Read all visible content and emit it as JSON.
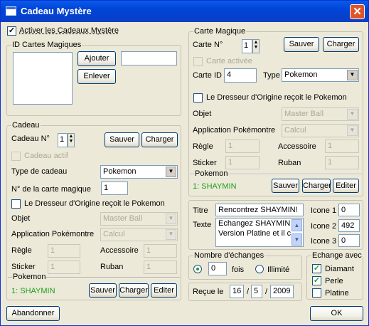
{
  "window": {
    "title": "Cadeau Mystère",
    "close_glyph": "✕"
  },
  "activate_label": "Activer les Cadeaux Mystère",
  "id_cards": {
    "title": "ID Cartes Magiques",
    "add": "Ajouter",
    "remove": "Enlever",
    "input_value": ""
  },
  "cadeau": {
    "title": "Cadeau",
    "num_label": "Cadeau N°",
    "num_value": "1",
    "save": "Sauver",
    "load": "Charger",
    "active_label": "Cadeau actif",
    "type_label": "Type de cadeau",
    "type_value": "Pokemon",
    "card_num_label": "N° de la carte magique",
    "card_num_value": "1",
    "trainer_label": "Le Dresseur d'Origine reçoit le Pokemon",
    "objet_label": "Objet",
    "objet_value": "Master Ball",
    "app_label": "Application Pokémontre",
    "app_value": "Calcul",
    "regle_label": "Règle",
    "regle_value": "1",
    "access_label": "Accessoire",
    "access_value": "1",
    "sticker_label": "Sticker",
    "sticker_value": "1",
    "ruban_label": "Ruban",
    "ruban_value": "1",
    "pokemon_title": "Pokemon",
    "pokemon_name": "1: SHAYMIN",
    "p_save": "Sauver",
    "p_load": "Charger",
    "p_edit": "Editer"
  },
  "carte": {
    "title": "Carte Magique",
    "num_label": "Carte N°",
    "num_value": "1",
    "save": "Sauver",
    "load": "Charger",
    "active_label": "Carte activée",
    "id_label": "Carte ID",
    "id_value": "4",
    "type_label": "Type",
    "type_value": "Pokemon",
    "trainer_label": "Le Dresseur d'Origine reçoit le Pokemon",
    "objet_label": "Objet",
    "objet_value": "Master Ball",
    "app_label": "Application Pokémontre",
    "app_value": "Calcul",
    "regle_label": "Règle",
    "regle_value": "1",
    "access_label": "Accessoire",
    "access_value": "1",
    "sticker_label": "Sticker",
    "sticker_value": "1",
    "ruban_label": "Ruban",
    "ruban_value": "1",
    "pokemon_title": "Pokemon",
    "pokemon_name": "1: SHAYMIN",
    "p_save": "Sauver",
    "p_load": "Charger",
    "p_edit": "Editer"
  },
  "message": {
    "titre_label": "Titre",
    "titre_value": "Rencontrez SHAYMIN!",
    "texte_label": "Texte",
    "texte_line1": "Echangez SHAYMIN",
    "texte_line2": "Version Platine et il ch",
    "icone1_label": "Icone 1",
    "icone1_value": "0",
    "icone2_label": "Icone 2",
    "icone2_value": "492",
    "icone3_label": "Icone 3",
    "icone3_value": "0"
  },
  "exchanges": {
    "title": "Nombre d'échanges",
    "count_value": "0",
    "fois_label": "fois",
    "unlimited_label": "Illimité"
  },
  "echange_avec": {
    "title": "Echange avec",
    "diamant": "Diamant",
    "perle": "Perle",
    "platine": "Platine"
  },
  "recu": {
    "label": "Reçue le",
    "day": "16",
    "month": "5",
    "year": "2009",
    "sep": "/"
  },
  "footer": {
    "cancel": "Abandonner",
    "ok": "OK"
  }
}
